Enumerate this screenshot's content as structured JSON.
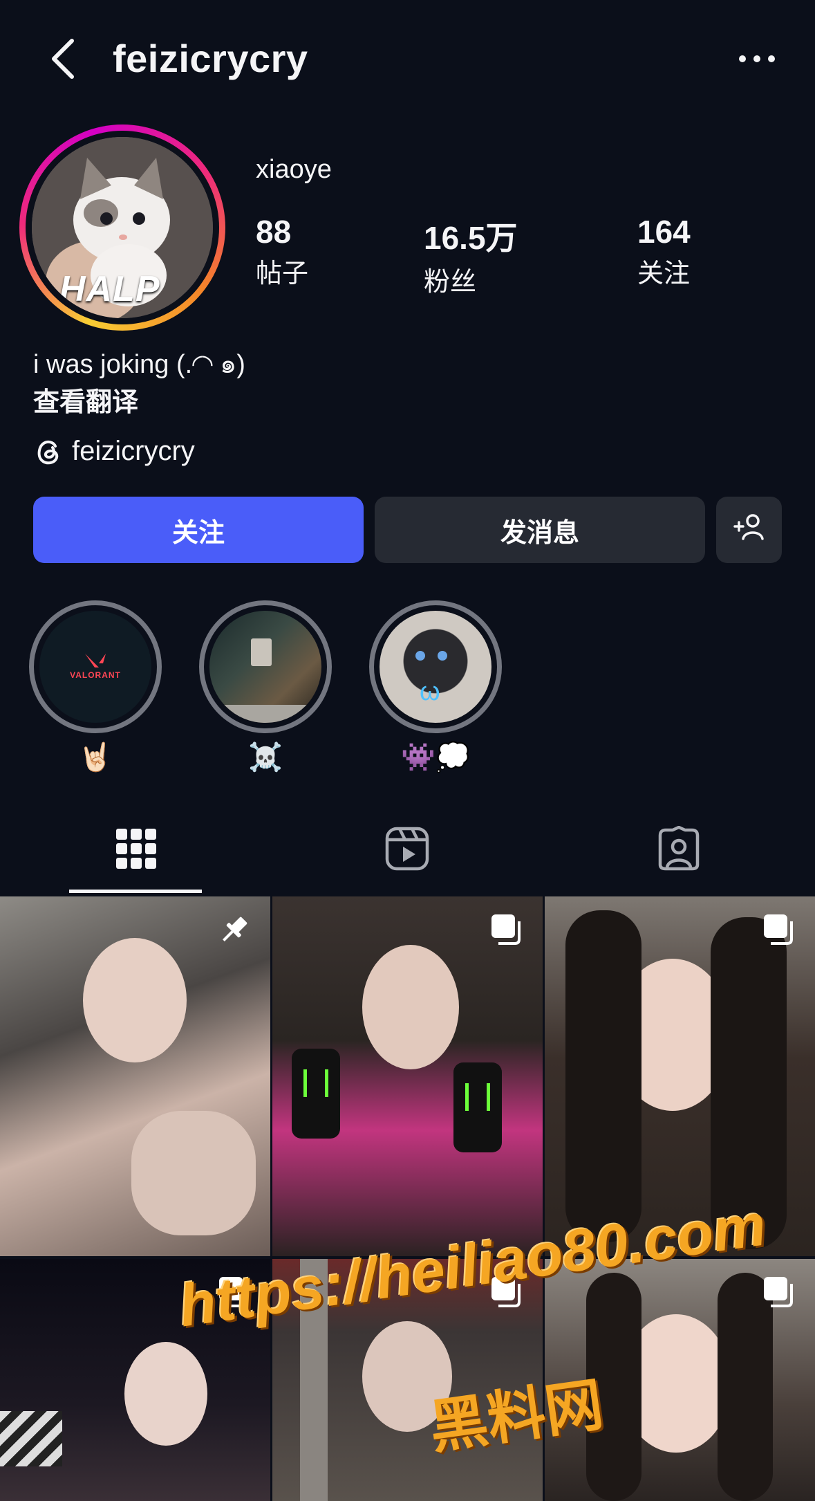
{
  "header": {
    "back": "back",
    "username": "feizicrycry",
    "more": "more"
  },
  "profile": {
    "avatar_text": "HALP",
    "display_name": "xiaoye",
    "stats": [
      {
        "value": "88",
        "label": "帖子"
      },
      {
        "value": "16.5万",
        "label": "粉丝"
      },
      {
        "value": "164",
        "label": "关注"
      }
    ],
    "bio": "i was joking (.◜◝ ๑)",
    "translate_label": "查看翻译",
    "threads_handle": "feizicrycry"
  },
  "actions": {
    "follow_label": "关注",
    "message_label": "发消息",
    "add_icon": "add-person-icon"
  },
  "highlights": [
    {
      "label": "🤘🏻",
      "cover_text": "VALORANT"
    },
    {
      "label": "☠️",
      "cover_text": ""
    },
    {
      "label": "👾💭",
      "cover_text": "ω"
    }
  ],
  "tabs": [
    {
      "name": "grid-icon",
      "active": true
    },
    {
      "name": "reels-icon",
      "active": false
    },
    {
      "name": "tagged-icon",
      "active": false
    }
  ],
  "posts": [
    {
      "badge": "pin-icon"
    },
    {
      "badge": "carousel-icon"
    },
    {
      "badge": "carousel-icon"
    },
    {
      "badge": "carousel-icon"
    },
    {
      "badge": "carousel-icon"
    },
    {
      "badge": "carousel-icon"
    }
  ],
  "watermark": {
    "url": "https://heiliao80.com",
    "name": "黑料网"
  },
  "colors": {
    "background": "#0b0f1a",
    "follow_button": "#4a5df9",
    "secondary_button": "#262a33"
  }
}
